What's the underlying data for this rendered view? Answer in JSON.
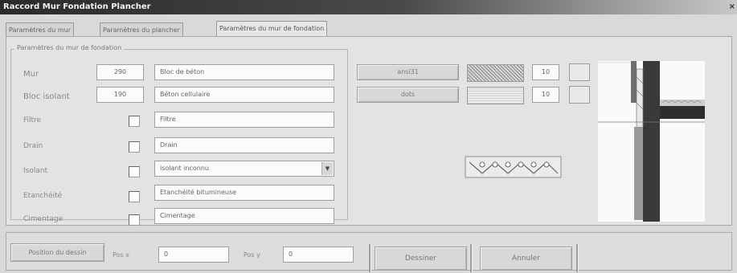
{
  "window": {
    "title": "Raccord Mur Fondation Plancher",
    "close": "×"
  },
  "tabs": [
    {
      "label": "Paramètres du mur"
    },
    {
      "label": "Paramètres du plancher"
    },
    {
      "label": "Paramètres du mur de fondation"
    }
  ],
  "group": {
    "title": "Paramètres du mur de fondation"
  },
  "rows": {
    "mur": {
      "label": "Mur",
      "value": "290",
      "material": "Bloc de béton"
    },
    "bloc_isolant": {
      "label": "Bloc isolant",
      "value": "190",
      "material": "Béton cellulaire"
    },
    "filtre": {
      "label": "Filtre",
      "material": "Filtre"
    },
    "drain": {
      "label": "Drain",
      "material": "Drain"
    },
    "isolant": {
      "label": "Isolant",
      "material": "isolant inconnu"
    },
    "etancheite": {
      "label": "Etanchéité",
      "material": "Etanchéité bitumineuse"
    },
    "cimentage": {
      "label": "Cimentage",
      "material": "Cimentage"
    }
  },
  "hatches": {
    "row1": {
      "button": "ansi31",
      "scale": "10"
    },
    "row2": {
      "button": "dots",
      "scale": "10"
    }
  },
  "bottom": {
    "position_button": "Position du dessin",
    "pos_x_label": "Pos x",
    "pos_x_value": "0",
    "pos_y_label": "Pos y",
    "pos_y_value": "0",
    "draw_button": "Dessiner",
    "cancel_button": "Annuler"
  }
}
